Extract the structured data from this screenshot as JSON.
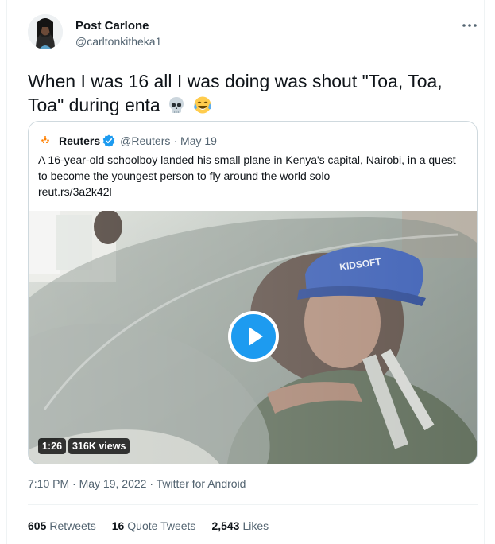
{
  "tweet": {
    "author_name": "Post Carlone",
    "author_handle": "@carltonkitheka1",
    "text": "When I was 16 all I was doing was shout \"Toa, Toa, Toa\" during enta",
    "emojis": [
      "skull-emoji",
      "tears-of-joy-emoji"
    ]
  },
  "quote": {
    "name": "Reuters",
    "handle": "@Reuters",
    "separator": "·",
    "date": "May 19",
    "text": "A 16-year-old schoolboy landed his small plane in Kenya's capital, Nairobi, in a quest to become the youngest person to fly around the world solo",
    "link": "reut.rs/3a2k42l",
    "video": {
      "duration": "1:26",
      "views": "316K views",
      "cap_text": "KIDSOFT"
    }
  },
  "meta": {
    "time": "7:10 PM",
    "sep1": "·",
    "date": "May 19, 2022",
    "sep2": "·",
    "source": "Twitter for Android"
  },
  "stats": {
    "retweets_count": "605",
    "retweets_label": "Retweets",
    "quotes_count": "16",
    "quotes_label": "Quote Tweets",
    "likes_count": "2,543",
    "likes_label": "Likes"
  },
  "colors": {
    "accent": "#1d9bf0",
    "text_primary": "#0f1419",
    "text_secondary": "#536471",
    "border": "#cfd9de"
  }
}
